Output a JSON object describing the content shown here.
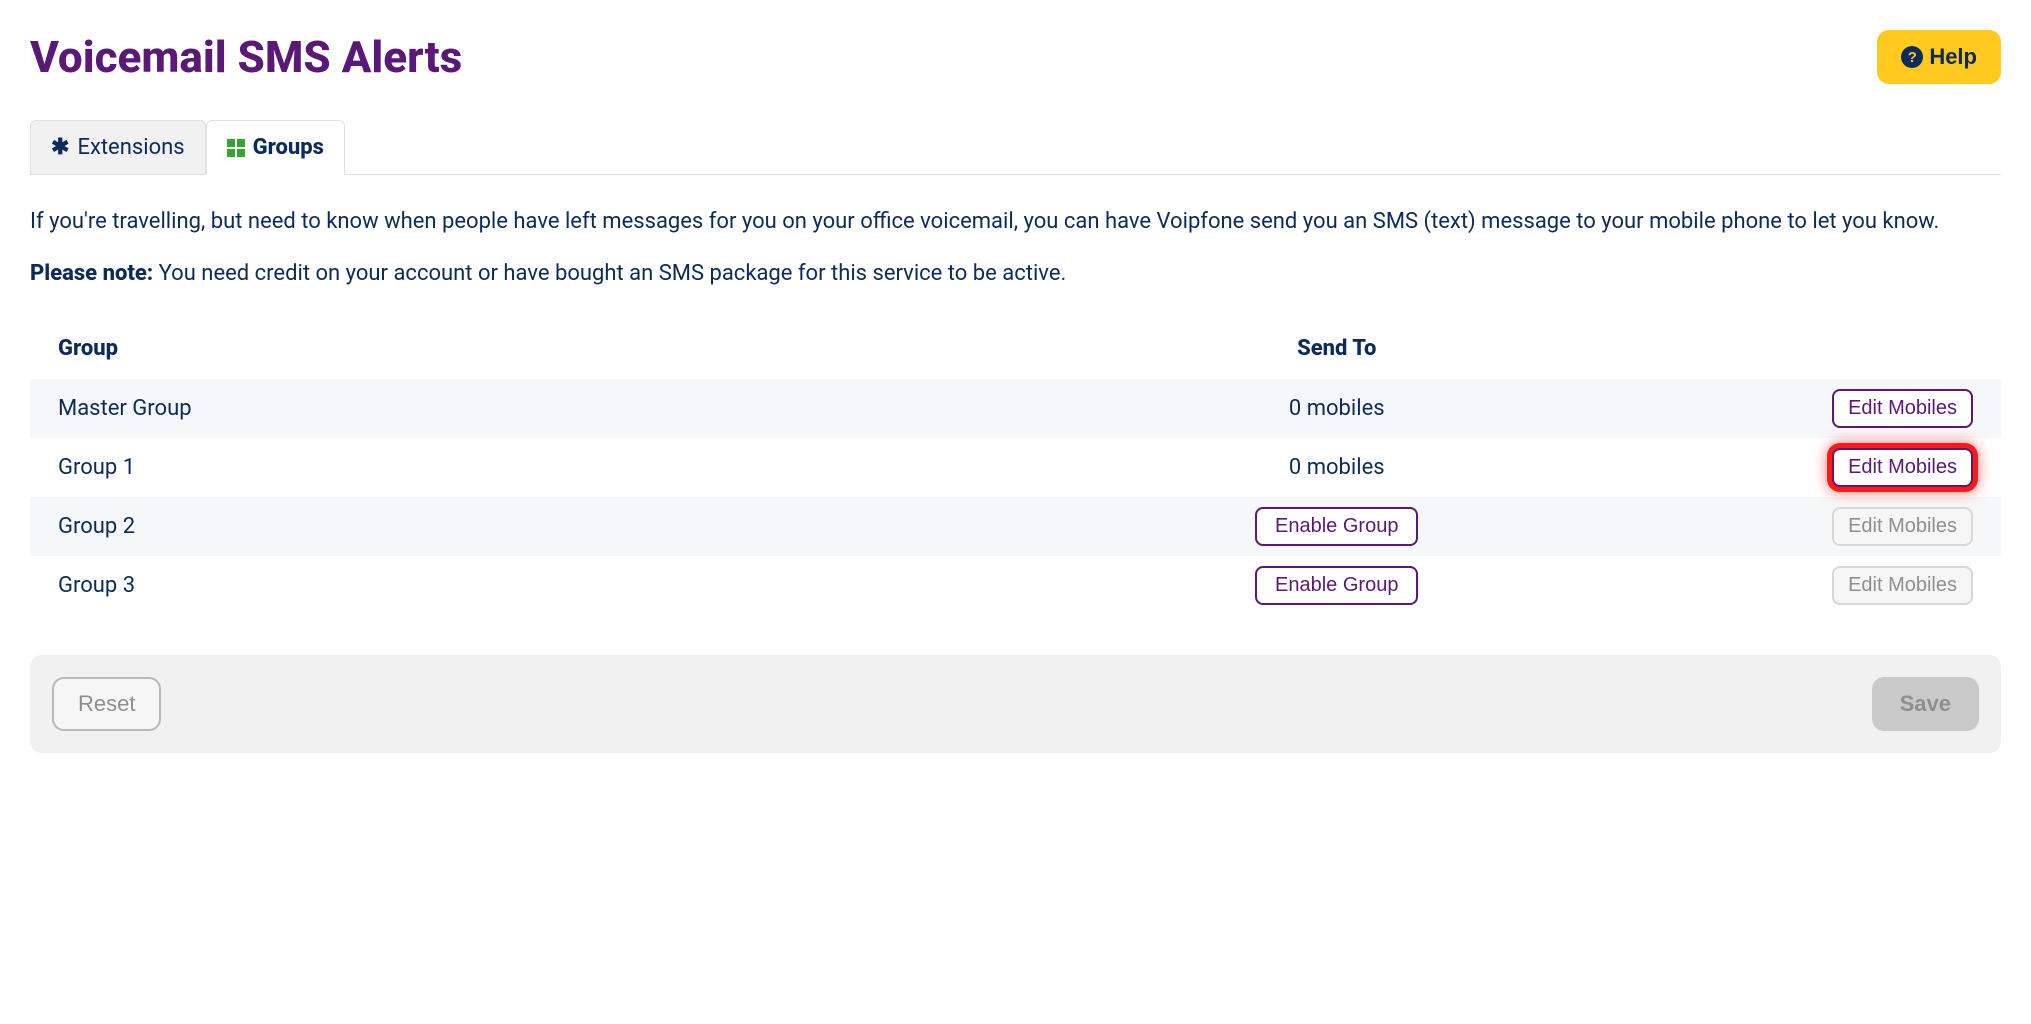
{
  "header": {
    "title": "Voicemail SMS Alerts",
    "help_label": "Help"
  },
  "tabs": {
    "extensions": "Extensions",
    "groups": "Groups"
  },
  "intro_text": "If you're travelling, but need to know when people have left messages for you on your office voicemail, you can have Voipfone send you an SMS (text) message to your mobile phone to let you know.",
  "note": {
    "label": "Please note:",
    "text": " You need credit on your account or have bought an SMS package for this service to be active."
  },
  "table": {
    "columns": {
      "group": "Group",
      "sendto": "Send To"
    },
    "edit_label": "Edit Mobiles",
    "enable_label": "Enable Group",
    "rows": [
      {
        "name": "Master Group",
        "sendto": "0 mobiles",
        "enabled": true,
        "highlighted": false
      },
      {
        "name": "Group 1",
        "sendto": "0 mobiles",
        "enabled": true,
        "highlighted": true
      },
      {
        "name": "Group 2",
        "sendto": "",
        "enabled": false,
        "highlighted": false
      },
      {
        "name": "Group 3",
        "sendto": "",
        "enabled": false,
        "highlighted": false
      }
    ]
  },
  "footer": {
    "reset": "Reset",
    "save": "Save"
  }
}
